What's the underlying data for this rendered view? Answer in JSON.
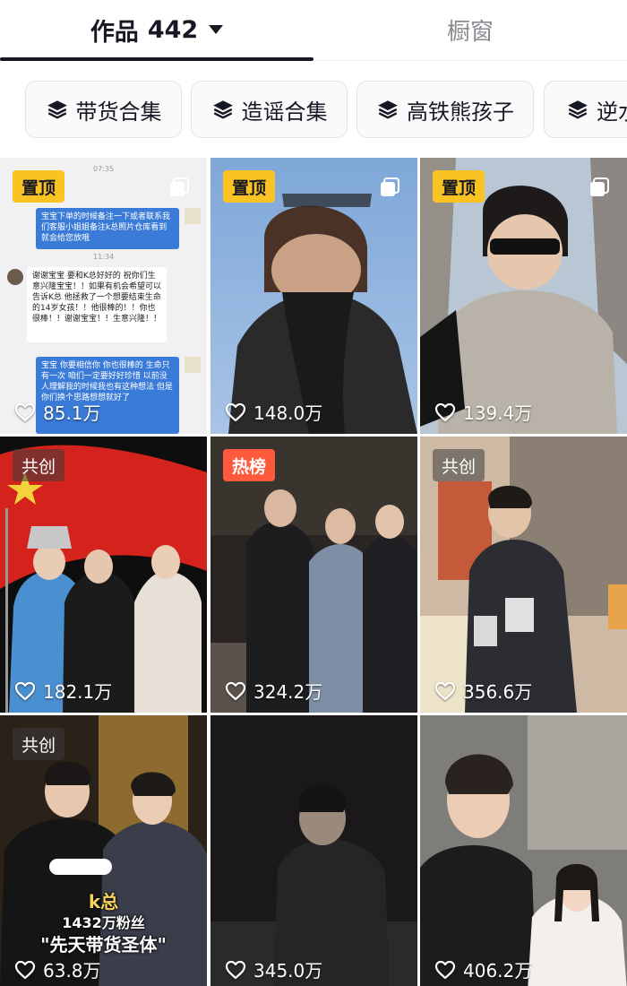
{
  "tabs": {
    "works_label": "作品",
    "works_count": "442",
    "window_label": "橱窗"
  },
  "collections": [
    {
      "label": "带货合集"
    },
    {
      "label": "造谣合集"
    },
    {
      "label": "高铁熊孩子"
    },
    {
      "label": "逆水"
    }
  ],
  "grid": {
    "items": [
      {
        "badge": "置顶",
        "likes": "85.1万"
      },
      {
        "badge": "置顶",
        "likes": "148.0万"
      },
      {
        "badge": "置顶",
        "likes": "139.4万"
      },
      {
        "badge": "共创",
        "likes": "182.1万"
      },
      {
        "badge": "热榜",
        "likes": "324.2万"
      },
      {
        "badge": "共创",
        "likes": "356.6万"
      },
      {
        "badge": "共创",
        "likes": "63.8万"
      },
      {
        "badge": "",
        "likes": "345.0万"
      },
      {
        "badge": "",
        "likes": "406.2万"
      }
    ]
  },
  "thumb_text": {
    "chat_lines": [
      "宝宝下单的时候备注一下或者联系我们客服小姐姐备注k总照片仓库看到就会给您放哦",
      "谢谢宝宝 要和K总好好的 祝你们生意兴隆宝宝！！如果有机会希望可以告诉K总 他拯救了一个想要结束生命的14岁女孩！！他很棒的！！你也很棒！！谢谢宝宝！！生意兴隆！！",
      "宝宝 你要相信你 你也很棒的 生命只有一次 咱们一定要好好珍惜 以前没人理解我的时候我也有这种想法 但是你们换个思路想想就好了"
    ],
    "chat_times": [
      "07:35",
      "11:34"
    ],
    "promo_name": "k总",
    "promo_fans": "1432万粉丝",
    "promo_slogan": "\"先天带货圣体\""
  },
  "colors": {
    "pin_badge": "#f8c323",
    "hot_badge": "#ff5a3c",
    "collab_badge": "rgba(60,60,60,0.55)",
    "text_primary": "#161823",
    "text_secondary": "#8a8b91"
  },
  "icons": {
    "caret": "caret-down-icon",
    "collection": "layers-icon",
    "like": "heart-icon",
    "multi": "multi-image-icon"
  }
}
